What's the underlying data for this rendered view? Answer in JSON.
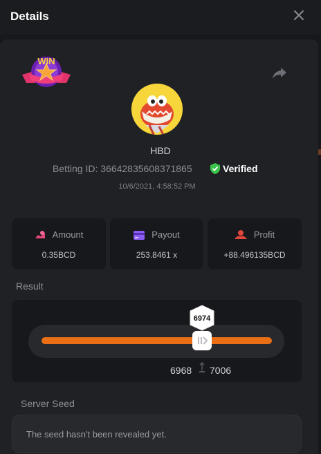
{
  "header": {
    "title": "Details"
  },
  "player": {
    "name": "HBD"
  },
  "bet": {
    "id_text": "Betting ID: 36642835608371865",
    "verified": "Verified",
    "datetime": "10/6/2021, 4:58:52 PM"
  },
  "cards": {
    "amount": {
      "label": "Amount",
      "value": "0.35BCD"
    },
    "payout": {
      "label": "Payout",
      "value": "253.8461 x"
    },
    "profit": {
      "label": "Profit",
      "value": "+88.496135BCD"
    }
  },
  "result": {
    "label": "Result",
    "value": "6974",
    "range_low": "6968",
    "range_high": "7006"
  },
  "seed": {
    "label": "Server Seed",
    "text": "The seed hasn't been revealed yet."
  },
  "badge": {
    "text": "WIN"
  },
  "colors": {
    "accent": "#ea6f14",
    "verified_green": "#3bc44b",
    "amount_icon": "#e04878",
    "payout_icon": "#8b5cf6",
    "profit_icon": "#e0463c"
  },
  "icons": [
    "close-icon",
    "share-icon",
    "verified-shield-icon",
    "amount-icon",
    "payout-card-icon",
    "profit-icon",
    "range-icon"
  ]
}
